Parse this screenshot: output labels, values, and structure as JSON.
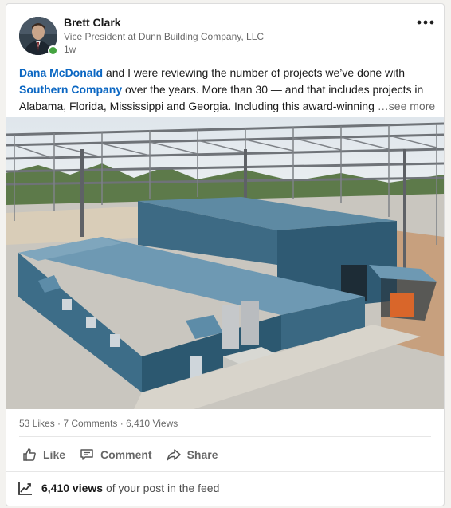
{
  "author": {
    "name": "Brett Clark",
    "headline": "Vice President at Dunn Building Company, LLC",
    "time": "1w"
  },
  "post": {
    "mention_1": "Dana McDonald",
    "text_1": " and I were reviewing the number of projects we’ve done with ",
    "mention_2": "Southern Company",
    "text_2": " over the years. More than 30 — and that includes projects in Alabama, Florida, Mississippi and Georgia. Including this award-winning ",
    "see_more": "…see more"
  },
  "image": {
    "icon": "photo-building-icon"
  },
  "social": {
    "likes": "53 Likes",
    "sep1": " · ",
    "comments": "7 Comments",
    "sep2": " · ",
    "views": "6,410 Views"
  },
  "actions": {
    "like": "Like",
    "comment": "Comment",
    "share": "Share"
  },
  "analytics": {
    "views_count": "6,410 views",
    "suffix": " of your post in the feed"
  },
  "colors": {
    "link": "#0a66c2",
    "online": "#44a340",
    "building": "#3e6a82"
  }
}
